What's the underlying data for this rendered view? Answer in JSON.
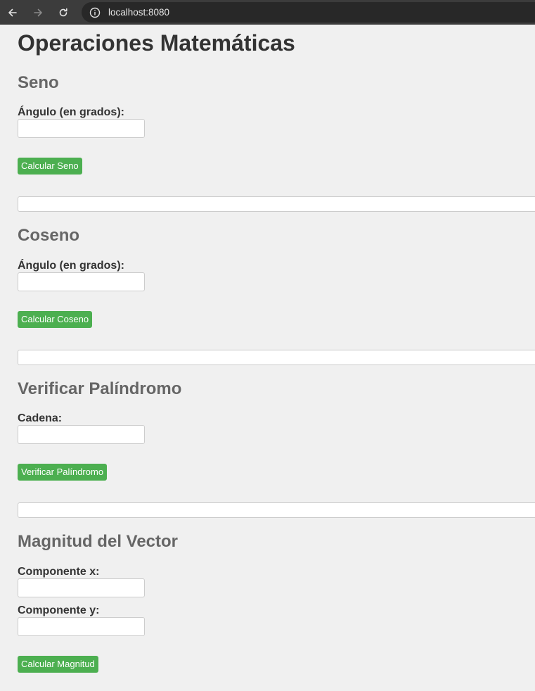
{
  "browser": {
    "url": "localhost:8080"
  },
  "page": {
    "title": "Operaciones Matemáticas"
  },
  "seno": {
    "title": "Seno",
    "angle_label": "Ángulo (en grados):",
    "angle_value": "",
    "button_label": "Calcular Seno",
    "result": ""
  },
  "coseno": {
    "title": "Coseno",
    "angle_label": "Ángulo (en grados):",
    "angle_value": "",
    "button_label": "Calcular Coseno",
    "result": ""
  },
  "palindromo": {
    "title": "Verificar Palíndromo",
    "string_label": "Cadena:",
    "string_value": "",
    "button_label": "Verificar Palíndromo",
    "result": ""
  },
  "vector": {
    "title": "Magnitud del Vector",
    "x_label": "Componente x:",
    "x_value": "",
    "y_label": "Componente y:",
    "y_value": "",
    "button_label": "Calcular Magnitud"
  },
  "colors": {
    "button_green": "#4caf50",
    "heading_gray": "#666666",
    "text_dark": "#333333",
    "page_background": "#f0f0f0"
  }
}
